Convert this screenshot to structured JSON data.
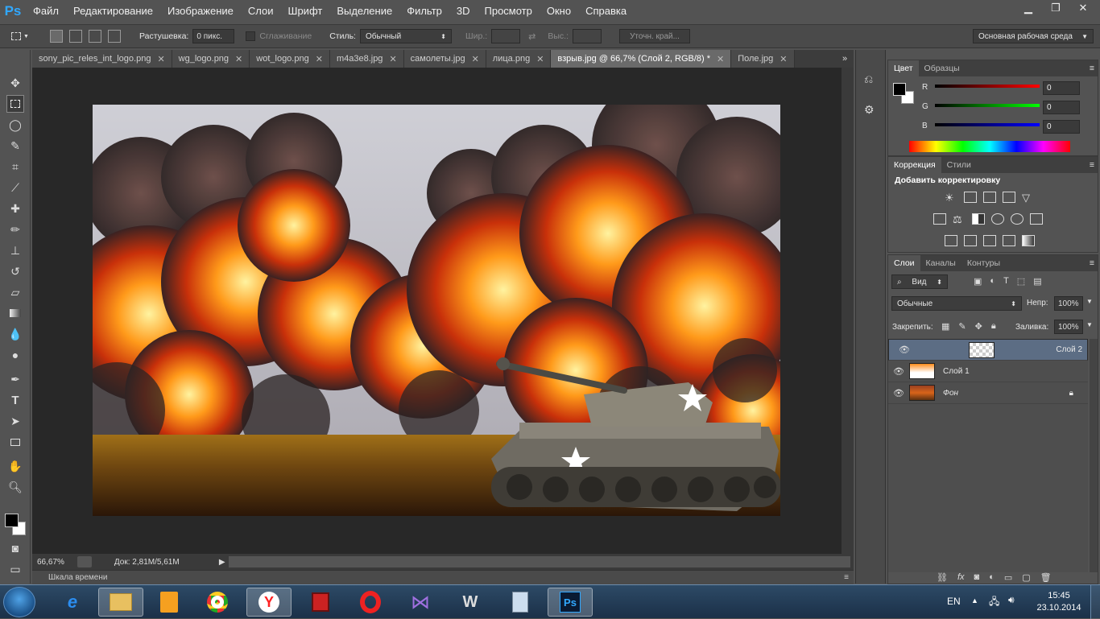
{
  "menu": {
    "logo": "Ps",
    "items": [
      "Файл",
      "Редактирование",
      "Изображение",
      "Слои",
      "Шрифт",
      "Выделение",
      "Фильтр",
      "3D",
      "Просмотр",
      "Окно",
      "Справка"
    ]
  },
  "options": {
    "feather_label": "Растушевка:",
    "feather_value": "0 пикс.",
    "antialias_label": "Сглаживание",
    "style_label": "Стиль:",
    "style_value": "Обычный",
    "width_label": "Шир.:",
    "height_label": "Выс.:",
    "refine_edge": "Уточн. край...",
    "workspace": "Основная рабочая среда"
  },
  "tabs": [
    {
      "label": "sony_pic_reles_int_logo.png"
    },
    {
      "label": "wg_logo.png"
    },
    {
      "label": "wot_logo.png"
    },
    {
      "label": "m4a3e8.jpg"
    },
    {
      "label": "самолеты.jpg"
    },
    {
      "label": "лица.png"
    },
    {
      "label": "взрыв.jpg @ 66,7% (Слой 2, RGB/8) *",
      "active": true
    },
    {
      "label": "Поле.jpg"
    }
  ],
  "status": {
    "zoom": "66,67%",
    "doc": "Док: 2,81M/5,61M"
  },
  "timeline": "Шкала времени",
  "color_panel": {
    "tabs": [
      "Цвет",
      "Образцы"
    ],
    "channels": [
      {
        "name": "R",
        "value": "0"
      },
      {
        "name": "G",
        "value": "0"
      },
      {
        "name": "B",
        "value": "0"
      }
    ]
  },
  "adjust_panel": {
    "tabs": [
      "Коррекция",
      "Стили"
    ],
    "heading": "Добавить корректировку"
  },
  "layers_panel": {
    "tabs": [
      "Слои",
      "Каналы",
      "Контуры"
    ],
    "filter": "Вид",
    "blend_mode": "Обычные",
    "opacity_label": "Непр:",
    "opacity_value": "100%",
    "lock_label": "Закрепить:",
    "fill_label": "Заливка:",
    "fill_value": "100%",
    "layers": [
      {
        "name": "Слой 2",
        "selected": true
      },
      {
        "name": "Слой 1",
        "selected": false
      },
      {
        "name": "Фон",
        "selected": false,
        "locked": true
      }
    ]
  },
  "taskbar": {
    "lang": "EN",
    "time": "15:45",
    "date": "23.10.2014"
  },
  "colors": {
    "accent": "#31a8ff",
    "selected_layer": "#5c6d84"
  }
}
